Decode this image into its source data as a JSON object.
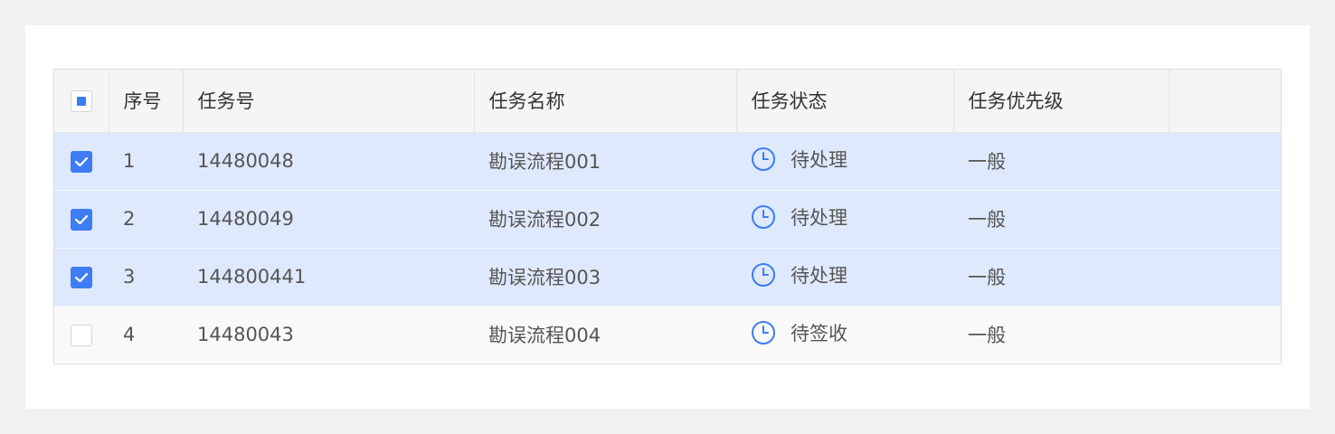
{
  "table": {
    "headers": {
      "index": "序号",
      "task_no": "任务号",
      "task_name": "任务名称",
      "task_status": "任务状态",
      "task_priority": "任务优先级",
      "extra": ""
    },
    "select_all_state": "indeterminate",
    "rows": [
      {
        "checked": true,
        "index": "1",
        "task_no": "14480048",
        "task_name": "勘误流程001",
        "status_icon": "clock-icon",
        "status": "待处理",
        "priority": "一般"
      },
      {
        "checked": true,
        "index": "2",
        "task_no": "14480049",
        "task_name": "勘误流程002",
        "status_icon": "clock-icon",
        "status": "待处理",
        "priority": "一般"
      },
      {
        "checked": true,
        "index": "3",
        "task_no": "144800441",
        "task_name": "勘误流程003",
        "status_icon": "clock-icon",
        "status": "待处理",
        "priority": "一般"
      },
      {
        "checked": false,
        "index": "4",
        "task_no": "14480043",
        "task_name": "勘误流程004",
        "status_icon": "clock-icon",
        "status": "待签收",
        "priority": "一般"
      }
    ]
  },
  "colors": {
    "accent": "#3d7cf3",
    "selected_row_bg": "#dfe9fd",
    "header_bg": "#f5f5f5",
    "page_bg": "#f2f2f2"
  }
}
